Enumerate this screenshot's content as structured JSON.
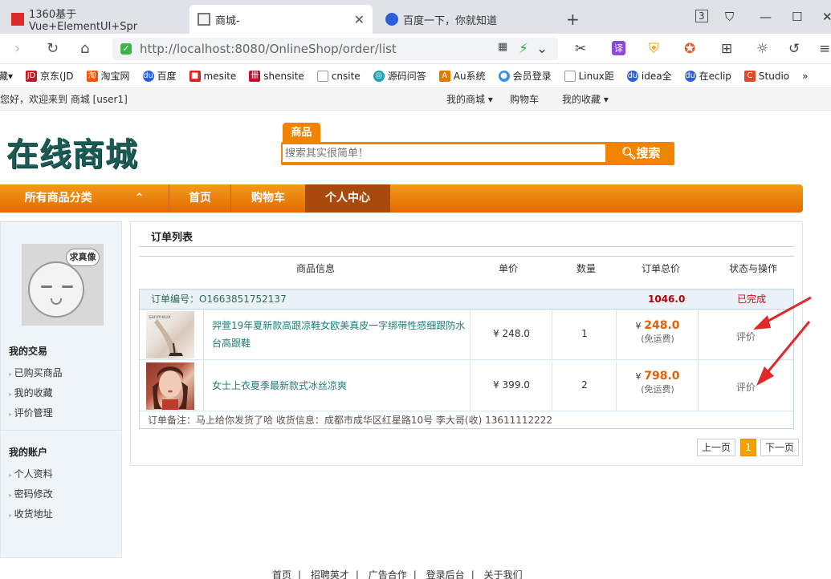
{
  "browser": {
    "tabs": [
      {
        "title": "1360基于Vue+ElementUI+Spr"
      },
      {
        "title": "商城-"
      },
      {
        "title": "百度一下，你就知道"
      }
    ],
    "url": "http://localhost:8080/OnlineShop/order/list",
    "bookmarks": [
      "藏",
      "京东(JD",
      "淘宝网",
      "百度",
      "mesite",
      "shensite",
      "cnsite",
      "源码问答",
      "Au系统",
      "会员登录",
      "Linux距",
      "idea全",
      "在eclip",
      "Studio"
    ],
    "more": "»"
  },
  "topbar": {
    "welcome": "您好，欢迎来到 商城 [user1]",
    "links": [
      "我的商城 ▾",
      "购物车",
      "我的收藏 ▾"
    ]
  },
  "header": {
    "logo": "在线商城",
    "search_tab": "商品",
    "search_placeholder": "搜索其实很简单！",
    "search_button": "搜索"
  },
  "nav": {
    "items": [
      "所有商品分类",
      "首页",
      "购物车",
      "个人中心"
    ],
    "caret": "⌃"
  },
  "sidebar": {
    "avatar_bubble": "求真像",
    "groups": [
      {
        "title": "我的交易",
        "items": [
          "已购买商品",
          "我的收藏",
          "评价管理"
        ]
      },
      {
        "title": "我的账户",
        "items": [
          "个人资料",
          "密码修改",
          "收货地址"
        ]
      }
    ]
  },
  "orders": {
    "title": "订单列表",
    "columns": [
      "商品信息",
      "单价",
      "数量",
      "订单总价",
      "状态与操作"
    ],
    "order_no_label": "订单编号：O1663851752137",
    "order_total": "1046.0",
    "status": "已完成",
    "items": [
      {
        "name": "羿萱19年夏新款高跟凉鞋女欧美真皮一字绑带性感细跟防水台高跟鞋",
        "price": "¥ 248.0",
        "qty": "1",
        "yen": "¥",
        "total": "248.0",
        "shipping": "(免运费)",
        "action": "评价"
      },
      {
        "name": "女士上衣夏季最新款式冰丝凉爽",
        "price": "¥ 399.0",
        "qty": "2",
        "yen": "¥",
        "total": "798.0",
        "shipping": "(免运费)",
        "action": "评价"
      }
    ],
    "remark": "订单备注：马上给你发货了哈  收货信息：成都市成华区红星路10号 李大哥(收) 13611112222",
    "pager": {
      "prev": "上一页",
      "current": "1",
      "next": "下一页"
    }
  },
  "footer": {
    "links": [
      "首页",
      "招聘英才",
      "广告合作",
      "登录后台",
      "关于我们"
    ],
    "sep": "|"
  },
  "colors": {
    "accent": "#f08300",
    "nav_active": "#a84a0e",
    "price": "#e85e00",
    "link": "#1b7f74"
  }
}
